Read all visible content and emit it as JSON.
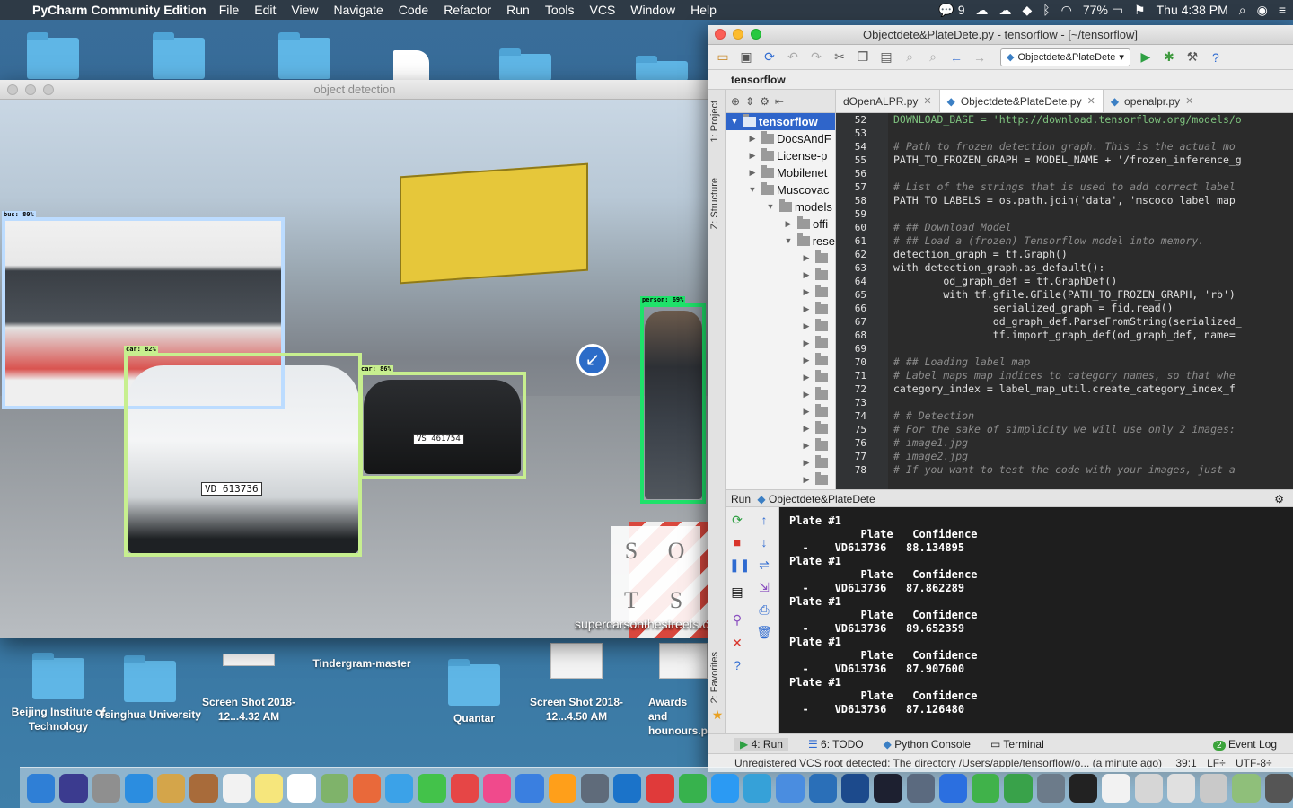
{
  "menubar": {
    "app_name": "PyCharm Community Edition",
    "items": [
      "File",
      "Edit",
      "View",
      "Navigate",
      "Code",
      "Refactor",
      "Run",
      "Tools",
      "VCS",
      "Window",
      "Help"
    ],
    "wechat_count": "9",
    "battery": "77%",
    "clock": "Thu 4:38 PM"
  },
  "desktop_icons": [
    {
      "label": "Beijing Institute of Technology",
      "kind": "folder"
    },
    {
      "label": "Tsinghua University",
      "kind": "folder"
    },
    {
      "label": "Screen Shot 2018-12...4.32 AM",
      "kind": "screenshot"
    },
    {
      "label": "Tindergram-master",
      "kind": "folder"
    },
    {
      "label": "Quantar",
      "kind": "folder"
    },
    {
      "label": "Screen Shot 2018-12...4.50 AM",
      "kind": "screenshot"
    },
    {
      "label": "Awards and hounours.png",
      "kind": "screenshot"
    }
  ],
  "detection_window": {
    "title": "object detection",
    "detections": [
      {
        "label": "bus: 80%",
        "color": "#bcdcff"
      },
      {
        "label": "car: 82%",
        "color": "#c7ef8f"
      },
      {
        "label": "car: 86%",
        "color": "#c7ef8f"
      },
      {
        "label": "person: 69%",
        "color": "#1fe26a"
      }
    ],
    "plate_text_front": "VD 613736",
    "plate_text_rear": "VS 461754",
    "sots_letters": [
      "S",
      "O",
      "T",
      "S"
    ],
    "watermark": "supercarsonthestreets.com"
  },
  "pycharm": {
    "title": "Objectdete&PlateDete.py - tensorflow - [~/tensorflow]",
    "run_config": "Objectdete&PlateDete",
    "breadcrumb": "tensorflow",
    "side_tabs": {
      "project": "1: Project",
      "structure": "Z: Structure",
      "favorites": "2: Favorites"
    },
    "tree": [
      {
        "label": "tensorflow",
        "arrow": "▼",
        "selected": true
      },
      {
        "label": "DocsAndF",
        "arrow": "▶"
      },
      {
        "label": "License-p",
        "arrow": "▶"
      },
      {
        "label": "Mobilenet",
        "arrow": "▶"
      },
      {
        "label": "Muscovac",
        "arrow": "▼"
      },
      {
        "label": "models",
        "arrow": "▼"
      },
      {
        "label": "offi",
        "arrow": "▶"
      },
      {
        "label": "rese",
        "arrow": "▼"
      }
    ],
    "tabs": [
      {
        "label": "dOpenALPR.py",
        "active": false
      },
      {
        "label": "Objectdete&PlateDete.py",
        "active": true
      },
      {
        "label": "openalpr.py",
        "active": false
      }
    ],
    "code_lines": [
      {
        "n": "52",
        "t": "DOWNLOAD_BASE = 'http://download.tensorflow.org/models/o",
        "c": "st"
      },
      {
        "n": "53",
        "t": "",
        "c": ""
      },
      {
        "n": "54",
        "t": "# Path to frozen detection graph. This is the actual mo",
        "c": "cm"
      },
      {
        "n": "55",
        "t": "PATH_TO_FROZEN_GRAPH = MODEL_NAME + '/frozen_inference_g",
        "c": ""
      },
      {
        "n": "56",
        "t": "",
        "c": ""
      },
      {
        "n": "57",
        "t": "# List of the strings that is used to add correct label",
        "c": "cm"
      },
      {
        "n": "58",
        "t": "PATH_TO_LABELS = os.path.join('data', 'mscoco_label_map",
        "c": ""
      },
      {
        "n": "59",
        "t": "",
        "c": ""
      },
      {
        "n": "60",
        "t": "# ## Download Model",
        "c": "cm"
      },
      {
        "n": "61",
        "t": "# ## Load a (frozen) Tensorflow model into memory.",
        "c": "cm"
      },
      {
        "n": "62",
        "t": "detection_graph = tf.Graph()",
        "c": ""
      },
      {
        "n": "63",
        "t": "with detection_graph.as_default():",
        "c": ""
      },
      {
        "n": "64",
        "t": "        od_graph_def = tf.GraphDef()",
        "c": ""
      },
      {
        "n": "65",
        "t": "        with tf.gfile.GFile(PATH_TO_FROZEN_GRAPH, 'rb')",
        "c": ""
      },
      {
        "n": "66",
        "t": "                serialized_graph = fid.read()",
        "c": ""
      },
      {
        "n": "67",
        "t": "                od_graph_def.ParseFromString(serialized_",
        "c": ""
      },
      {
        "n": "68",
        "t": "                tf.import_graph_def(od_graph_def, name=",
        "c": ""
      },
      {
        "n": "69",
        "t": "",
        "c": ""
      },
      {
        "n": "70",
        "t": "# ## Loading label map",
        "c": "cm"
      },
      {
        "n": "71",
        "t": "# Label maps map indices to category names, so that whe",
        "c": "cm"
      },
      {
        "n": "72",
        "t": "category_index = label_map_util.create_category_index_f",
        "c": ""
      },
      {
        "n": "73",
        "t": "",
        "c": ""
      },
      {
        "n": "74",
        "t": "# # Detection",
        "c": "cm"
      },
      {
        "n": "75",
        "t": "# For the sake of simplicity we will use only 2 images:",
        "c": "cm"
      },
      {
        "n": "76",
        "t": "# image1.jpg",
        "c": "cm"
      },
      {
        "n": "77",
        "t": "# image2.jpg",
        "c": "cm"
      },
      {
        "n": "78",
        "t": "# If you want to test the code with your images, just a",
        "c": "cm"
      }
    ],
    "run_header": "Run",
    "run_config_name": "Objectdete&PlateDete",
    "console_lines": [
      "Plate #1",
      "           Plate   Confidence",
      "  -    VD613736   88.134895",
      "Plate #1",
      "           Plate   Confidence",
      "  -    VD613736   87.862289",
      "Plate #1",
      "           Plate   Confidence",
      "  -    VD613736   89.652359",
      "Plate #1",
      "           Plate   Confidence",
      "  -    VD613736   87.907600",
      "Plate #1",
      "           Plate   Confidence",
      "  -    VD613736   87.126480"
    ],
    "bottom_tabs": [
      "4: Run",
      "6: TODO",
      "Python Console",
      "Terminal"
    ],
    "event_log": "Event Log",
    "event_count": "2",
    "status_message": "Unregistered VCS root detected: The directory /Users/apple/tensorflow/o... (a minute ago)",
    "cursor_pos": "39:1",
    "line_sep": "LF÷",
    "encoding": "UTF-8÷"
  },
  "dock_colors": [
    "#2f7fd6",
    "#3b3b8f",
    "#8f8f8f",
    "#2b8de0",
    "#d4a54a",
    "#a86b3a",
    "#f2f2f2",
    "#f6e67c",
    "#ffffff",
    "#7fb36a",
    "#e9693a",
    "#3ba2e8",
    "#43c24a",
    "#e64646",
    "#f04a8c",
    "#3a7fe0",
    "#ff9f1a",
    "#5f6b7a",
    "#1b73c9",
    "#e03a3a",
    "#37b24d",
    "#2b9af3",
    "#36a1d8",
    "#4a8de0",
    "#2a6fb8",
    "#1c4a8c",
    "#1d2030",
    "#5b6a7f",
    "#2b6fe0",
    "#40b24a",
    "#39a24a",
    "#6c7b8a",
    "#222222",
    "#f2f2f2",
    "#d6d6d6",
    "#e0e0e0",
    "#c9c9c9",
    "#8fbf7a",
    "#555555"
  ]
}
